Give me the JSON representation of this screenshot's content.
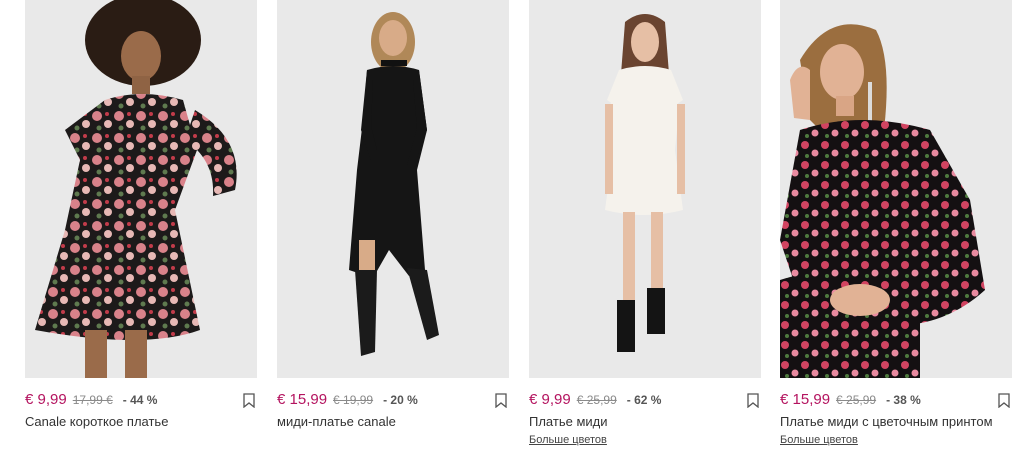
{
  "products": [
    {
      "price": "€ 9,99",
      "old_price": "17,99 €",
      "discount": "- 44 %",
      "name": "Canale короткое платье",
      "more_colors": ""
    },
    {
      "price": "€ 15,99",
      "old_price": "€ 19,99",
      "discount": "- 20 %",
      "name": "миди-платье canale",
      "more_colors": ""
    },
    {
      "price": "€ 9,99",
      "old_price": "€ 25,99",
      "discount": "- 62 %",
      "name": "Платье миди",
      "more_colors": "Больше цветов"
    },
    {
      "price": "€ 15,99",
      "old_price": "€ 25,99",
      "discount": "- 38 %",
      "name": "Платье миди с цветочным принтом",
      "more_colors": "Больше цветов"
    }
  ],
  "colors": {
    "price_accent": "#b4135f",
    "photo_bg": "#e9e9e9"
  },
  "icons": {
    "bookmark": "bookmark-icon"
  }
}
